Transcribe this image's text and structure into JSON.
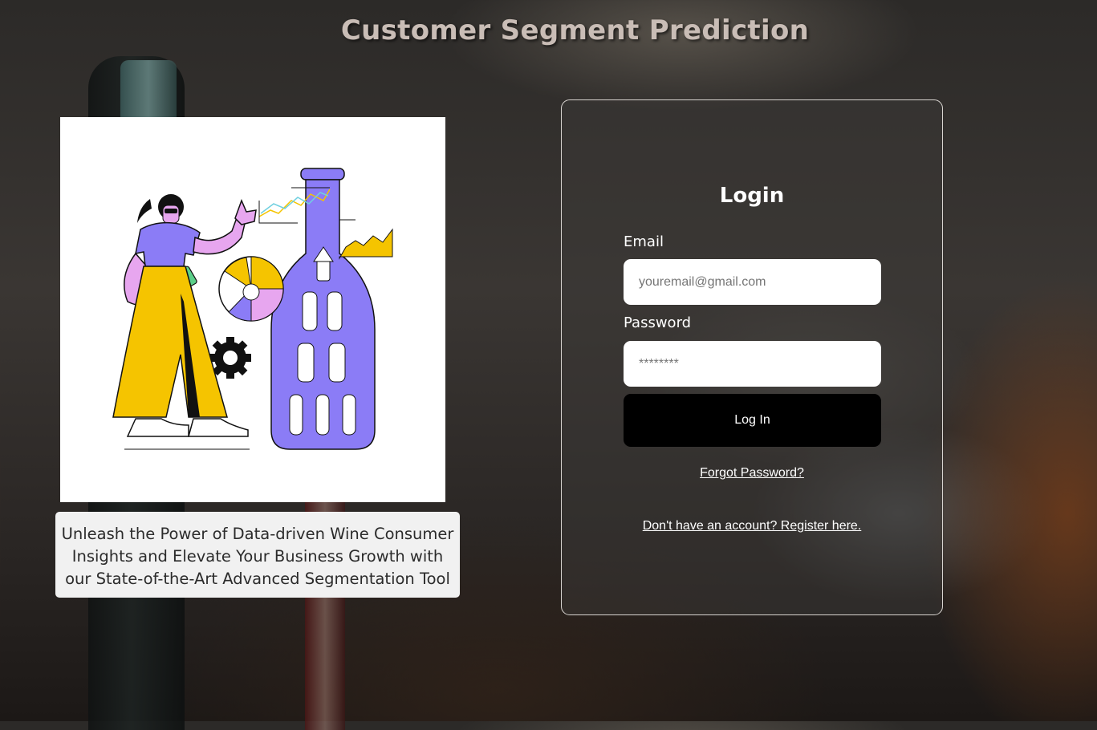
{
  "header": {
    "title": "Customer Segment Prediction"
  },
  "hero": {
    "illustration_icon": "wine-data-analyst-illustration",
    "tagline": "Unleash the Power of Data-driven Wine Consumer Insights and Elevate Your Business Growth with our State-of-the-Art Advanced Segmentation Tool"
  },
  "login": {
    "heading": "Login",
    "email_label": "Email",
    "email_placeholder": "youremail@gmail.com",
    "email_value": "",
    "password_label": "Password",
    "password_placeholder": "********",
    "password_value": "",
    "submit_label": "Log In",
    "forgot_link": "Forgot Password?",
    "register_link": "Don't have an account? Register here."
  },
  "colors": {
    "button_bg": "#000000",
    "title_color": "#c9bdb6",
    "illustration_purple": "#8b7cf6",
    "illustration_yellow": "#f5c400"
  }
}
